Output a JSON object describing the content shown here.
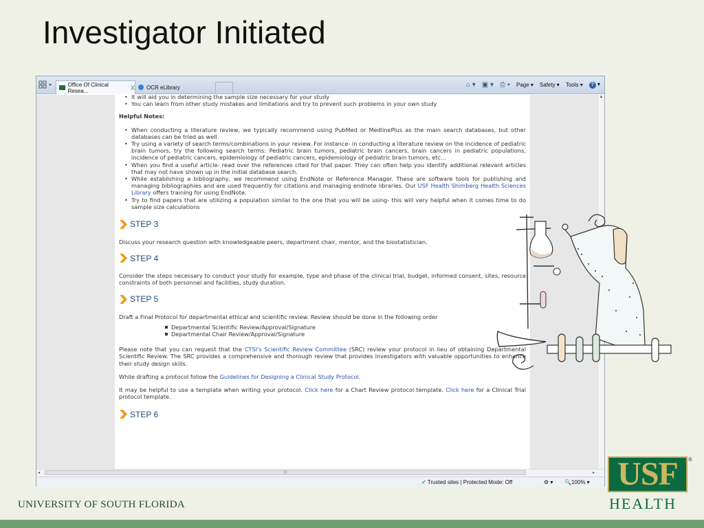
{
  "slide": {
    "title": "Investigator Initiated",
    "footer": "UNIVERSITY OF  SOUTH FLORIDA",
    "logo_text": "USF",
    "logo_sub": "HEALTH",
    "logo_reg": "®"
  },
  "colors": {
    "slide_bg": "#f0f1e6",
    "footer_bar": "#6f9f71",
    "usf_green": "#0b6a40",
    "usf_gold": "#cdb763",
    "step_orange": "#f19a1f",
    "link_blue": "#2a4fb2"
  },
  "browser": {
    "tabs": [
      {
        "label": "Office Of Clinical Resea...",
        "close": "X",
        "icon": "site-icon"
      },
      {
        "label": "OCR eLibrary",
        "icon": "ie-icon"
      }
    ],
    "toolbar": {
      "home": "home-icon",
      "feeds": "feeds-icon",
      "print": "print-icon",
      "page": "Page ▾",
      "safety": "Safety ▾",
      "tools": "Tools ▾",
      "help": "?"
    },
    "status": {
      "security": "Trusted sites | Protected Mode: Off",
      "zoom": "100%"
    }
  },
  "content": {
    "intro_bullets": [
      "It will aid you in determining the sample size necessary for your study",
      "You can learn from other study mistakes and limitations and try to prevent such problems in your own study"
    ],
    "helpful_notes_heading": "Helpful Notes:",
    "notes": {
      "n1": "When conducting a literature review, we typically recommend using PubMed or MedlinePlus as the main search databases, but other databases can be tried as well.",
      "n2": "Try using a variety of search terms/combinations in your review. For instance- in conducting a literature review on the incidence of pediatric brain tumors, try the following search terms: Pediatric brain tumors, pediatric brain cancers, brain cancers in pediatric populations, incidence of pediatric cancers, epidemiology of pediatric cancers, epidemiology of pediatric brain tumors, etc…",
      "n3": "When you find a useful article- read over the references cited for that paper. They can often help you identify additional relevant articles that may not have shown up in the initial database search.",
      "n4_pre": "While establishing a bibliography, we recommend using EndNote or Reference Manager. These are software tools for publishing and managing bibliographies and are used frequently for citations and managing endnote libraries. Our ",
      "n4_link": "USF Health Shimberg Health Sciences Library",
      "n4_post": " offers training for using EndNote.",
      "n5": "Try to find papers that are utilizing a population similar to the one that you will be using- this will very helpful when it comes time to do sample size calculations"
    },
    "step3": {
      "label": "STEP 3",
      "text": "Discuss your research question with knowledgeable peers, department chair, mentor, and the biostatistician."
    },
    "step4": {
      "label": "STEP 4",
      "text": "Consider the steps necessary to conduct your study for example, type and phase of the clinical trial, budget, informed consent, sites, resource constraints of both personnel and facilities, study duration."
    },
    "step5": {
      "label": "STEP 5",
      "text": "Draft a Final Protocol for departmental ethical and scientific review. Review should be done in the following order",
      "order": [
        "Departmental Scientific Review/Approval/Signature",
        "Departmental Chair Review/Approval/Signature"
      ],
      "src_pre": "Please note that you can request that the ",
      "src_link": "CTSI's Scientific Review Committee",
      "src_post": " (SRC) review your protocol in lieu of obtaining Departmental Scientific Review.  The SRC provides a comprehensive and thorough review that provides investigators with valuable opportunities to enhance their study design skills.",
      "guide_pre": "While drafting a protocol follow the ",
      "guide_link": "Guidelines for Designing a Clinical Study Protocol",
      "guide_post": ".",
      "tmpl_pre": "It may be helpful to use a template when writing your protocol. ",
      "tmpl_link1": "Click here",
      "tmpl_mid": " for a Chart Review protocol template. ",
      "tmpl_link2": "Click here",
      "tmpl_post": " for a Clinical Trial protocol template."
    },
    "step6": {
      "label": "STEP 6"
    }
  }
}
